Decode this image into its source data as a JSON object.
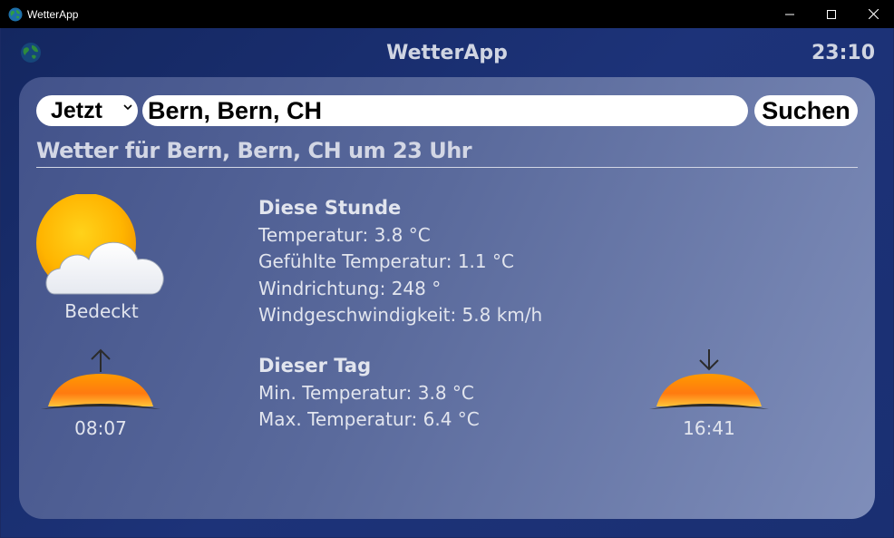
{
  "window": {
    "title": "WetterApp",
    "controls": [
      "minimize-icon",
      "maximize-icon",
      "close-icon"
    ]
  },
  "header": {
    "title": "WetterApp",
    "clock": "23:10"
  },
  "search": {
    "time_option": "Jetzt",
    "location": "Bern, Bern, CH",
    "button_label": "Suchen"
  },
  "heading": "Wetter für Bern, Bern, CH um 23 Uhr",
  "current": {
    "icon": "sun-behind-cloud-icon",
    "condition": "Bedeckt"
  },
  "hour": {
    "heading": "Diese Stunde",
    "temperature": "Temperatur: 3.8 °C",
    "feels_like": "Gefühlte Temperatur: 1.1 °C",
    "wind_direction": "Windrichtung: 248 °",
    "wind_speed": "Windgeschwindigkeit: 5.8 km/h"
  },
  "day": {
    "heading": "Dieser Tag",
    "min_temperature": "Min. Temperatur: 3.8 °C",
    "max_temperature": "Max. Temperatur: 6.4 °C"
  },
  "sunrise": {
    "icon": "sunrise-icon",
    "time": "08:07"
  },
  "sunset": {
    "icon": "sunset-icon",
    "time": "16:41"
  },
  "colors": {
    "titlebar": "#000000",
    "background": "#1b2a63",
    "card_start": "#42528a",
    "card_end": "#7f8eba",
    "text": "#e2e5ee",
    "sun_orange": "#ff9a1e"
  }
}
